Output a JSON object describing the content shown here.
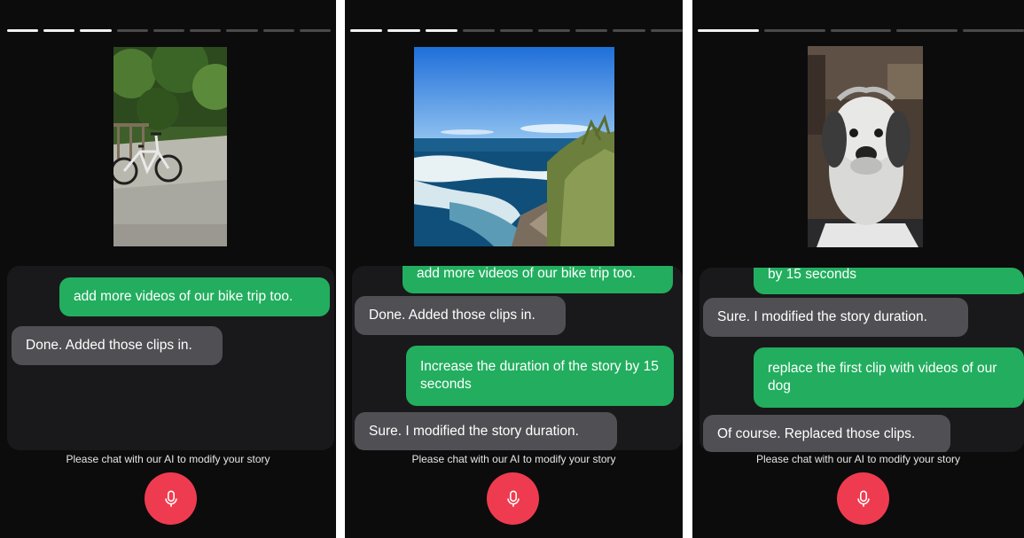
{
  "panels": [
    {
      "progress": {
        "total": 9,
        "viewed": 3
      },
      "media_subject": "bicycle-in-park",
      "messages": [
        {
          "role": "user",
          "text": "add more videos of our bike trip too."
        },
        {
          "role": "ai",
          "text": "Done. Added those clips in."
        }
      ],
      "hint": "Please chat with our AI to modify your story",
      "mic_icon": "microphone-icon"
    },
    {
      "progress": {
        "total": 9,
        "viewed": 3
      },
      "media_subject": "ocean-coastline",
      "messages": [
        {
          "role": "user",
          "text": "add more videos of our bike trip too."
        },
        {
          "role": "ai",
          "text": "Done. Added those clips in."
        },
        {
          "role": "user",
          "text": "Increase the duration of the story by 15 seconds"
        },
        {
          "role": "ai",
          "text": "Sure. I modified the story duration."
        }
      ],
      "hint": "Please chat with our AI to modify your story",
      "mic_icon": "microphone-icon"
    },
    {
      "progress": {
        "total": 5,
        "viewed": 1
      },
      "media_subject": "dog-portrait",
      "messages": [
        {
          "role": "user",
          "text": "by 15 seconds"
        },
        {
          "role": "ai",
          "text": "Sure. I modified the story duration."
        },
        {
          "role": "user",
          "text": "replace the first clip with videos of our dog"
        },
        {
          "role": "ai",
          "text": "Of course. Replaced those clips."
        }
      ],
      "hint": "Please chat with our AI to modify your story",
      "mic_icon": "microphone-icon"
    }
  ],
  "colors": {
    "background": "#0c0c0d",
    "chat_area": "#19191b",
    "user_bubble": "#22ae5e",
    "ai_bubble": "#505054",
    "mic_button": "#ef3b4f",
    "progress_on": "#f2f2f2",
    "progress_off": "#4a4a4c"
  }
}
